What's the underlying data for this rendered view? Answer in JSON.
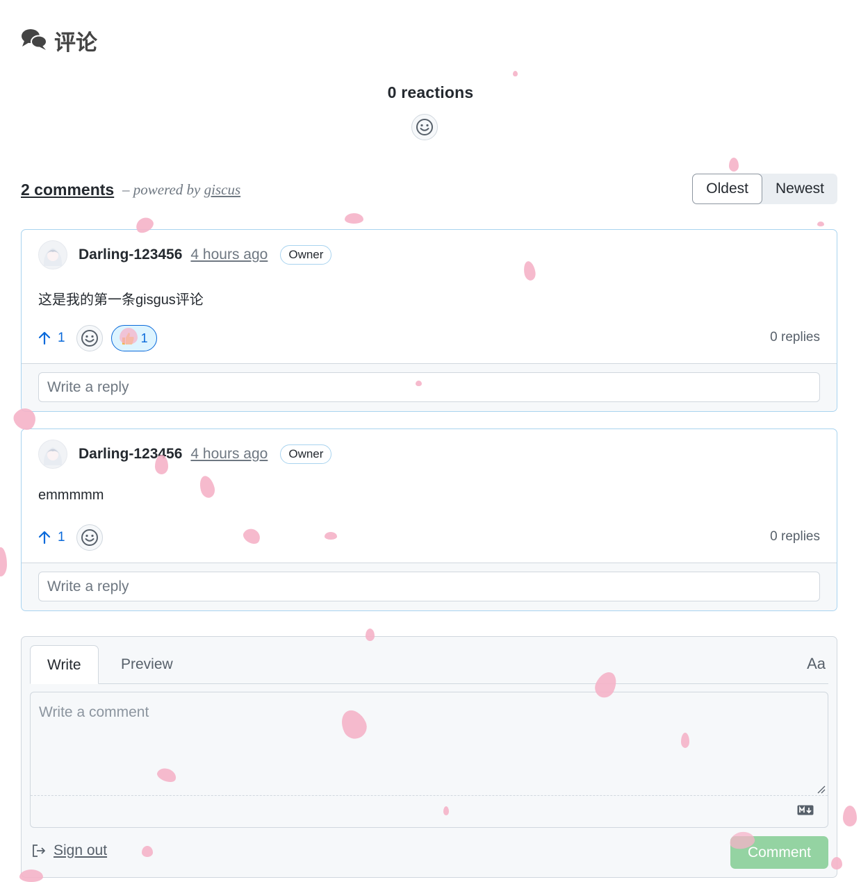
{
  "section": {
    "title": "评论",
    "icon": "comments-icon"
  },
  "reactions": {
    "count_label": "0 reactions"
  },
  "comments_bar": {
    "count_label": "2 comments",
    "powered_prefix": "– powered by",
    "powered_link": "giscus",
    "sort_options": [
      "Oldest",
      "Newest"
    ],
    "sort_selected": "Oldest"
  },
  "comments": [
    {
      "author": "Darling-123456",
      "time": "4 hours ago",
      "badge": "Owner",
      "body": "这是我的第一条gisgus评论",
      "upvotes": "1",
      "reaction_count": "1",
      "replies": "0 replies",
      "reply_placeholder": "Write a reply"
    },
    {
      "author": "Darling-123456",
      "time": "4 hours ago",
      "badge": "Owner",
      "body": "emmmmm",
      "upvotes": "1",
      "replies": "0 replies",
      "reply_placeholder": "Write a reply"
    }
  ],
  "editor": {
    "tabs": [
      "Write",
      "Preview"
    ],
    "font_toggle": "Aa",
    "placeholder": "Write a comment",
    "sign_out": "Sign out",
    "submit": "Comment"
  },
  "colors": {
    "accent": "#0969da",
    "submit_disabled": "#94d3a2",
    "petal": "#f5b3c8",
    "comment_border": "#a8d3ef"
  }
}
